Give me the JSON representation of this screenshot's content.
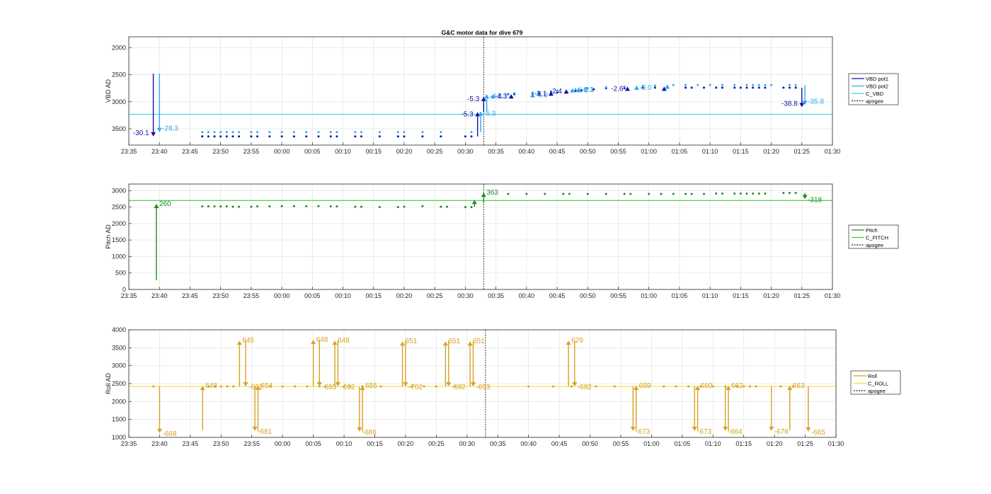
{
  "figure": {
    "title": "G&C motor data for dive 679"
  },
  "colors": {
    "vbd1": "#1010A8",
    "vbd2": "#2CA8F0",
    "c_vbd": "#38D8E8",
    "pitch": "#1E8C1E",
    "c_pitch": "#40C840",
    "roll": "#D8A020",
    "c_roll": "#F0E040",
    "apogee": "#222222",
    "grid": "#E6E6E6"
  },
  "chart_data": [
    {
      "id": "vbd",
      "type": "scatter",
      "title": "G&C motor data for dive 679",
      "ylabel": "VBD AD",
      "y_reversed": true,
      "ylim": [
        1800,
        3800
      ],
      "yticks": [
        2000,
        2500,
        3000,
        3500
      ],
      "xlim": [
        "23:35",
        "01:30"
      ],
      "xticks": [
        "23:35",
        "23:40",
        "23:45",
        "23:50",
        "23:55",
        "00:00",
        "00:05",
        "00:10",
        "00:15",
        "00:20",
        "00:25",
        "00:30",
        "00:35",
        "00:40",
        "00:45",
        "00:50",
        "00:55",
        "01:00",
        "01:05",
        "01:10",
        "01:15",
        "01:20",
        "01:25",
        "01:30"
      ],
      "grid": true,
      "legend": {
        "placement": "outside-right",
        "entries": [
          "VBD pot1",
          "VBD pot2",
          "C_VBD",
          "apogee"
        ]
      },
      "reference_lines": [
        {
          "name": "C_VBD",
          "y": 3230
        }
      ],
      "apogee_x": "00:33",
      "series": [
        {
          "name": "VBD pot1",
          "color_key": "vbd1",
          "x": [
            "23:47",
            "23:48",
            "23:49",
            "23:50",
            "23:51",
            "23:52",
            "23:53",
            "23:55",
            "23:56",
            "23:58",
            "00:00",
            "00:02",
            "00:04",
            "00:06",
            "00:08",
            "00:09",
            "00:12",
            "00:13",
            "00:16",
            "00:19",
            "00:20",
            "00:23",
            "00:26",
            "00:30",
            "00:31",
            "00:37",
            "00:38",
            "00:41",
            "00:42",
            "00:44",
            "00:45",
            "00:48",
            "00:49",
            "00:51",
            "00:53",
            "00:56",
            "00:59",
            "01:01",
            "01:03",
            "01:06",
            "01:07",
            "01:09",
            "01:11",
            "01:12",
            "01:14",
            "01:15",
            "01:16",
            "01:17",
            "01:18",
            "01:19",
            "01:22",
            "01:23",
            "01:24"
          ],
          "values": [
            3640,
            3640,
            3640,
            3640,
            3640,
            3640,
            3640,
            3640,
            3640,
            3640,
            3640,
            3640,
            3640,
            3640,
            3640,
            3640,
            3640,
            3640,
            3640,
            3640,
            3640,
            3640,
            3640,
            3640,
            3640,
            2860,
            2860,
            2850,
            2850,
            2840,
            2830,
            2800,
            2790,
            2770,
            2750,
            2750,
            2740,
            2740,
            2740,
            2740,
            2740,
            2740,
            2740,
            2740,
            2740,
            2740,
            2740,
            2740,
            2740,
            2740,
            2740,
            2740,
            2740
          ]
        },
        {
          "name": "VBD pot2",
          "color_key": "vbd2",
          "x": [
            "23:47",
            "23:48",
            "23:49",
            "23:50",
            "23:51",
            "23:52",
            "23:53",
            "23:55",
            "23:56",
            "23:58",
            "00:00",
            "00:02",
            "00:04",
            "00:06",
            "00:08",
            "00:09",
            "00:12",
            "00:13",
            "00:16",
            "00:19",
            "00:20",
            "00:23",
            "00:26",
            "00:31",
            "00:37",
            "00:38",
            "00:41",
            "00:42",
            "00:44",
            "00:45",
            "00:48",
            "00:50",
            "00:53",
            "00:56",
            "00:59",
            "01:01",
            "01:04",
            "01:06",
            "01:08",
            "01:10",
            "01:12",
            "01:14",
            "01:16",
            "01:17",
            "01:18",
            "01:19",
            "01:20",
            "01:23",
            "01:24"
          ],
          "values": [
            3560,
            3560,
            3560,
            3560,
            3560,
            3560,
            3560,
            3560,
            3560,
            3560,
            3560,
            3560,
            3560,
            3560,
            3560,
            3560,
            3560,
            3560,
            3560,
            3560,
            3560,
            3560,
            3560,
            3560,
            2850,
            2840,
            2830,
            2820,
            2810,
            2790,
            2770,
            2750,
            2730,
            2720,
            2710,
            2700,
            2690,
            2690,
            2690,
            2690,
            2690,
            2690,
            2690,
            2690,
            2690,
            2690,
            2690,
            2690,
            2690
          ]
        }
      ],
      "moves": [
        {
          "series": "VBD pot1",
          "x": "23:39",
          "from": 2480,
          "to": 3640,
          "label": "-30.1"
        },
        {
          "series": "VBD pot2",
          "x": "23:40",
          "from": 2480,
          "to": 3560,
          "label": "-28.3"
        },
        {
          "series": "VBD pot1",
          "x": "00:32",
          "from": 3640,
          "to": 3190,
          "label": "-5.3"
        },
        {
          "series": "VBD pot2",
          "x": "00:32.5",
          "from": 3560,
          "to": 3180,
          "label": "-5.3"
        },
        {
          "series": "VBD pot1",
          "x": "00:33",
          "from": 3190,
          "to": 2910,
          "label": "-5.3"
        },
        {
          "series": "VBD pot2",
          "x": "00:33.5",
          "from": 3180,
          "to": 2860,
          "label": "-4.2"
        },
        {
          "series": "VBD pot2",
          "x": "00:34.5",
          "from": 2930,
          "to": 2860,
          "label": "-5.1"
        },
        {
          "series": "VBD pot1",
          "x": "00:37.5",
          "from": 2890,
          "to": 2860,
          "label": "-4.3"
        },
        {
          "series": "VBD pot2",
          "x": "00:41",
          "from": 2880,
          "to": 2840,
          "label": "-4.0"
        },
        {
          "series": "VBD pot1",
          "x": "00:44",
          "from": 2860,
          "to": 2810,
          "label": "-3.1"
        },
        {
          "series": "VBD pot1",
          "x": "00:46.5",
          "from": 2800,
          "to": 2770,
          "label": "-2.4"
        },
        {
          "series": "VBD pot2",
          "x": "00:47.5",
          "from": 2790,
          "to": 2750,
          "label": "-2.6"
        },
        {
          "series": "VBD pot2",
          "x": "00:48.5",
          "from": 2780,
          "to": 2740,
          "label": "-4.3"
        },
        {
          "series": "VBD pot1",
          "x": "00:56.5",
          "from": 2760,
          "to": 2720,
          "label": "-2.6"
        },
        {
          "series": "VBD pot2",
          "x": "00:58",
          "from": 2740,
          "to": 2700,
          "label": "-5.0"
        },
        {
          "series": "VBD pot1",
          "x": "01:02.5",
          "from": 2760,
          "to": 2720,
          "label": ""
        },
        {
          "series": "VBD pot2",
          "x": "01:03",
          "from": 2720,
          "to": 2680,
          "label": ""
        },
        {
          "series": "VBD pot1",
          "x": "01:25",
          "from": 2740,
          "to": 3100,
          "label": "-38.8"
        },
        {
          "series": "VBD pot2",
          "x": "01:25.5",
          "from": 2690,
          "to": 3060,
          "label": "-35.8"
        }
      ],
      "annotations": [
        {
          "x": "00:50",
          "y": 2820,
          "text": "-5.1",
          "color_key": "vbd2"
        }
      ]
    },
    {
      "id": "pitch",
      "type": "scatter",
      "ylabel": "Pitch AD",
      "ylim": [
        0,
        3200
      ],
      "yticks": [
        0,
        500,
        1000,
        1500,
        2000,
        2500,
        3000
      ],
      "xlim": [
        "23:35",
        "01:30"
      ],
      "xticks": [
        "23:35",
        "23:40",
        "23:45",
        "23:50",
        "23:55",
        "00:00",
        "00:05",
        "00:10",
        "00:15",
        "00:20",
        "00:25",
        "00:30",
        "00:35",
        "00:40",
        "00:45",
        "00:50",
        "00:55",
        "01:00",
        "01:05",
        "01:10",
        "01:15",
        "01:20",
        "01:25",
        "01:30"
      ],
      "grid": true,
      "legend": {
        "placement": "outside-right",
        "entries": [
          "Pitch",
          "C_PITCH",
          "apogee"
        ]
      },
      "reference_lines": [
        {
          "name": "C_PITCH",
          "y": 2700
        }
      ],
      "apogee_x": "00:33",
      "series": [
        {
          "name": "Pitch",
          "color_key": "pitch",
          "x": [
            "23:47",
            "23:48",
            "23:49",
            "23:50",
            "23:51",
            "23:52",
            "23:53",
            "23:55",
            "23:56",
            "23:58",
            "00:00",
            "00:02",
            "00:04",
            "00:06",
            "00:08",
            "00:09",
            "00:12",
            "00:13",
            "00:16",
            "00:19",
            "00:20",
            "00:23",
            "00:26",
            "00:27",
            "00:30",
            "00:31",
            "00:37",
            "00:40",
            "00:43",
            "00:46",
            "00:47",
            "00:50",
            "00:53",
            "00:56",
            "00:57",
            "01:00",
            "01:02",
            "01:04",
            "01:06",
            "01:07",
            "01:09",
            "01:11",
            "01:12",
            "01:14",
            "01:15",
            "01:16",
            "01:17",
            "01:18",
            "01:19",
            "01:22",
            "01:23",
            "01:24"
          ],
          "values": [
            2520,
            2520,
            2520,
            2520,
            2520,
            2510,
            2510,
            2510,
            2520,
            2520,
            2530,
            2530,
            2530,
            2530,
            2520,
            2520,
            2510,
            2510,
            2500,
            2500,
            2510,
            2530,
            2510,
            2510,
            2500,
            2500,
            2900,
            2900,
            2900,
            2900,
            2900,
            2900,
            2900,
            2900,
            2900,
            2900,
            2900,
            2900,
            2900,
            2900,
            2900,
            2910,
            2910,
            2910,
            2910,
            2910,
            2910,
            2910,
            2910,
            2930,
            2930,
            2930
          ]
        }
      ],
      "moves": [
        {
          "series": "Pitch",
          "x": "23:39.5",
          "from": 280,
          "to": 2600,
          "label": "260"
        },
        {
          "series": "Pitch",
          "x": "00:31.5",
          "from": 2510,
          "to": 2720,
          "label": ""
        },
        {
          "series": "Pitch",
          "x": "00:33",
          "from": 2620,
          "to": 2940,
          "label": "363"
        },
        {
          "series": "Pitch",
          "x": "01:25.5",
          "from": 2930,
          "to": 2740,
          "label": "-318"
        }
      ]
    },
    {
      "id": "roll",
      "type": "scatter",
      "ylabel": "Roll AD",
      "ylim": [
        1000,
        4000
      ],
      "yticks": [
        1000,
        1500,
        2000,
        2500,
        3000,
        3500,
        4000
      ],
      "xlim": [
        "23:35",
        "01:30"
      ],
      "xticks": [
        "23:35",
        "23:40",
        "23:45",
        "23:50",
        "23:55",
        "00:00",
        "00:05",
        "00:10",
        "00:15",
        "00:20",
        "00:25",
        "00:30",
        "00:35",
        "00:40",
        "00:45",
        "00:50",
        "00:55",
        "01:00",
        "01:05",
        "01:10",
        "01:15",
        "01:20",
        "01:25",
        "01:30"
      ],
      "grid": true,
      "legend": {
        "placement": "outside-right",
        "entries": [
          "Roll",
          "C_ROLL",
          "apogee"
        ]
      },
      "reference_lines": [
        {
          "name": "C_ROLL",
          "y": 2420
        }
      ],
      "apogee_x": "00:33",
      "series": [
        {
          "name": "Roll",
          "color_key": "roll",
          "x": [
            "23:39",
            "23:48",
            "23:49",
            "23:50",
            "23:51",
            "23:52",
            "23:58",
            "24:00",
            "24:02",
            "24:04",
            "24:06",
            "24:07",
            "24:10",
            "24:11",
            "24:13",
            "24:16",
            "24:21",
            "24:23",
            "24:25",
            "24:28",
            "24:40",
            "24:44",
            "24:47",
            "24:51",
            "24:54",
            "25:02",
            "25:04",
            "25:06",
            "25:08",
            "25:10",
            "25:12",
            "25:14",
            "25:15",
            "25:16",
            "25:17",
            "25:21",
            "25:23"
          ],
          "values": [
            2420,
            2420,
            2420,
            2420,
            2420,
            2420,
            2420,
            2420,
            2420,
            2420,
            2420,
            2420,
            2420,
            2420,
            2420,
            2420,
            2420,
            2420,
            2420,
            2420,
            2420,
            2420,
            2420,
            2420,
            2420,
            2420,
            2420,
            2420,
            2420,
            2420,
            2420,
            2420,
            2420,
            2420,
            2420,
            2420,
            2420
          ]
        }
      ],
      "moves": [
        {
          "series": "Roll",
          "x": "23:40",
          "from": 2420,
          "to": 1120,
          "label": "-668"
        },
        {
          "series": "Roll",
          "x": "23:47",
          "from": 1200,
          "to": 2440,
          "label": "648"
        },
        {
          "series": "Roll",
          "x": "23:53",
          "from": 2420,
          "to": 3700,
          "label": "645"
        },
        {
          "series": "Roll",
          "x": "23:54",
          "from": 3700,
          "to": 2420,
          "label": "-692"
        },
        {
          "series": "Roll",
          "x": "23:55.5",
          "from": 2420,
          "to": 1180,
          "label": "-681"
        },
        {
          "series": "Roll",
          "x": "23:56",
          "from": 1180,
          "to": 2440,
          "label": "654"
        },
        {
          "series": "Roll",
          "x": "00:05",
          "from": 2420,
          "to": 3720,
          "label": "648"
        },
        {
          "series": "Roll",
          "x": "00:06",
          "from": 3720,
          "to": 2420,
          "label": "-695"
        },
        {
          "series": "Roll",
          "x": "00:08.5",
          "from": 2420,
          "to": 3700,
          "label": "648"
        },
        {
          "series": "Roll",
          "x": "00:09",
          "from": 3700,
          "to": 2420,
          "label": "-692"
        },
        {
          "series": "Roll",
          "x": "00:12.5",
          "from": 2420,
          "to": 1160,
          "label": "-686"
        },
        {
          "series": "Roll",
          "x": "00:13",
          "from": 1160,
          "to": 2440,
          "label": "655"
        },
        {
          "series": "Roll",
          "x": "00:19.5",
          "from": 2420,
          "to": 3680,
          "label": "651"
        },
        {
          "series": "Roll",
          "x": "00:20",
          "from": 3680,
          "to": 2420,
          "label": "-702"
        },
        {
          "series": "Roll",
          "x": "00:26.5",
          "from": 2420,
          "to": 3680,
          "label": "651"
        },
        {
          "series": "Roll",
          "x": "00:27",
          "from": 3680,
          "to": 2420,
          "label": "-692"
        },
        {
          "series": "Roll",
          "x": "00:30.5",
          "from": 2420,
          "to": 3680,
          "label": "651"
        },
        {
          "series": "Roll",
          "x": "00:31",
          "from": 3680,
          "to": 2420,
          "label": "-693"
        },
        {
          "series": "Roll",
          "x": "00:46.5",
          "from": 2420,
          "to": 3700,
          "label": "629"
        },
        {
          "series": "Roll",
          "x": "00:47.5",
          "from": 3700,
          "to": 2420,
          "label": "-682"
        },
        {
          "series": "Roll",
          "x": "00:57",
          "from": 2420,
          "to": 1180,
          "label": "-673"
        },
        {
          "series": "Roll",
          "x": "00:57.5",
          "from": 1180,
          "to": 2440,
          "label": "659"
        },
        {
          "series": "Roll",
          "x": "01:07",
          "from": 2420,
          "to": 1180,
          "label": "-673"
        },
        {
          "series": "Roll",
          "x": "01:07.5",
          "from": 1180,
          "to": 2440,
          "label": "660"
        },
        {
          "series": "Roll",
          "x": "01:12",
          "from": 2420,
          "to": 1180,
          "label": "-664"
        },
        {
          "series": "Roll",
          "x": "01:12.5",
          "from": 1180,
          "to": 2440,
          "label": "662"
        },
        {
          "series": "Roll",
          "x": "01:19.5",
          "from": 2420,
          "to": 1180,
          "label": "-676"
        },
        {
          "series": "Roll",
          "x": "01:22.5",
          "from": 1200,
          "to": 2440,
          "label": "663"
        },
        {
          "series": "Roll",
          "x": "01:25.5",
          "from": 2420,
          "to": 1160,
          "label": "-665"
        }
      ]
    }
  ]
}
